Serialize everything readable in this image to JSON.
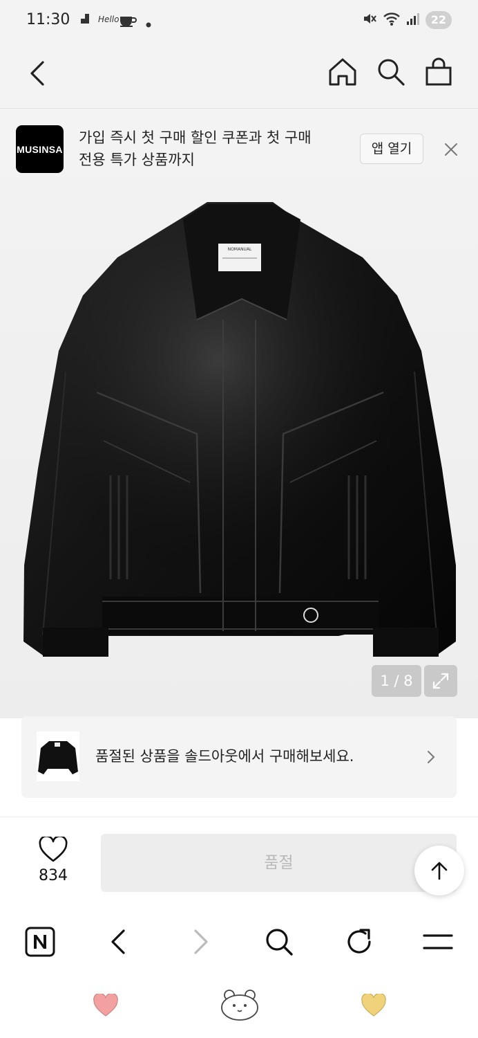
{
  "status_bar": {
    "time": "11:30",
    "notification_icons": [
      "file-icon",
      "app-text-icon",
      "coffee-icon",
      "dot-icon"
    ],
    "app_text": "Hello",
    "battery": "22"
  },
  "top_nav": {
    "icons": [
      "back-icon",
      "home-icon",
      "search-icon",
      "shopping-bag-icon"
    ]
  },
  "banner": {
    "logo_text": "MUSINSA",
    "line1": "가입 즉시 첫 구매 할인 쿠폰과 첫 구매",
    "line2": "전용 특가 상품까지",
    "app_open_label": "앱 열기"
  },
  "product": {
    "image_counter": "1 / 8",
    "label_text": "NOMANUAL"
  },
  "soldout_card": {
    "message": "품절된 상품을 솔드아웃에서 구매해보세요."
  },
  "action_bar": {
    "like_count": "834",
    "soldout_label": "품절"
  },
  "browser_bar": {
    "icons": [
      "naver-icon",
      "back-arrow-icon",
      "forward-arrow-icon",
      "search-icon",
      "refresh-icon",
      "menu-icon"
    ]
  },
  "bottom_row": {
    "icons": [
      "heart-pink-icon",
      "bear-icon",
      "heart-yellow-icon"
    ]
  },
  "colors": {
    "background": "#f3f3f3",
    "logo_bg": "#000000",
    "soldout_button_bg": "#ededed",
    "soldout_button_text": "#b9b9b9",
    "pink_heart": "#f2a0a0",
    "yellow_heart": "#f0d27a"
  }
}
